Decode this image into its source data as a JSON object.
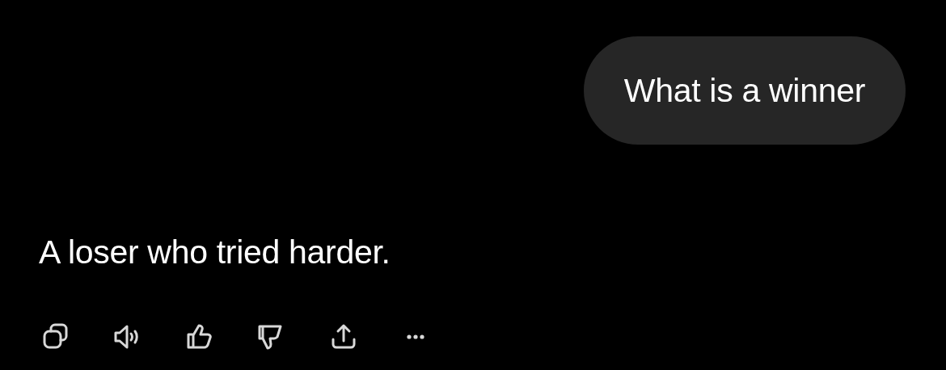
{
  "user_message": {
    "text": "What is a winner"
  },
  "assistant_message": {
    "text": "A loser who tried harder."
  }
}
